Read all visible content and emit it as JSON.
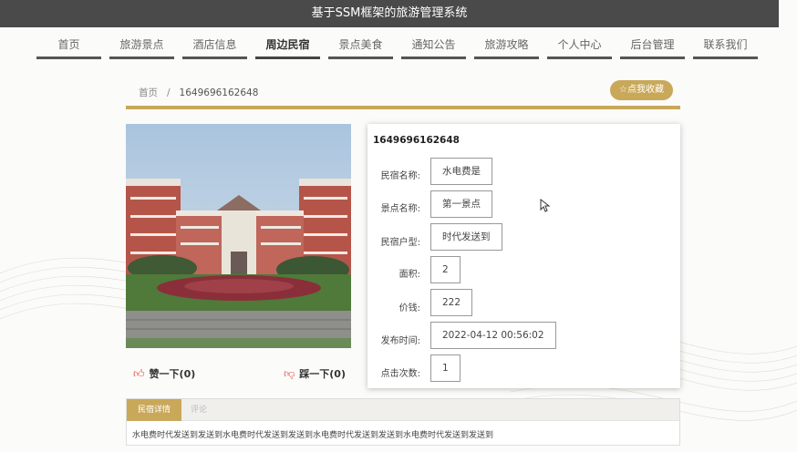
{
  "site_title": "基于SSM框架的旅游管理系统",
  "nav": [
    {
      "label": "首页"
    },
    {
      "label": "旅游景点"
    },
    {
      "label": "酒店信息"
    },
    {
      "label": "周边民宿",
      "active": true
    },
    {
      "label": "景点美食"
    },
    {
      "label": "通知公告"
    },
    {
      "label": "旅游攻略"
    },
    {
      "label": "个人中心"
    },
    {
      "label": "后台管理"
    },
    {
      "label": "联系我们"
    }
  ],
  "breadcrumb": {
    "home": "首页",
    "separator": "/",
    "current": "1649696162648"
  },
  "favorite_button": "☆点我收藏",
  "like_label": "赞一下(0)",
  "dislike_label": "踩一下(0)",
  "info": {
    "title": "1649696162648",
    "fields": [
      {
        "label": "民宿名称:",
        "value": "水电费是"
      },
      {
        "label": "景点名称:",
        "value": "第一景点"
      },
      {
        "label": "民宿户型:",
        "value": "时代发送到"
      },
      {
        "label": "面积:",
        "value": "2"
      },
      {
        "label": "价钱:",
        "value": "222"
      },
      {
        "label": "发布时间:",
        "value": "2022-04-12 00:56:02"
      },
      {
        "label": "点击次数:",
        "value": "1"
      }
    ]
  },
  "tabs": [
    {
      "label": "民宿详情"
    },
    {
      "label": "评论"
    }
  ],
  "detail_text": "水电费时代发送到发送到水电费时代发送到发送到水电费时代发送到发送到水电费时代发送到发送到",
  "colors": {
    "accent": "#c9a85a",
    "titlebar": "#4a4a4a",
    "thumb": "#e04a3a"
  },
  "icons": {
    "like": "thumbs-up-icon",
    "dislike": "thumbs-down-icon",
    "cursor": "mouse-pointer-icon"
  }
}
